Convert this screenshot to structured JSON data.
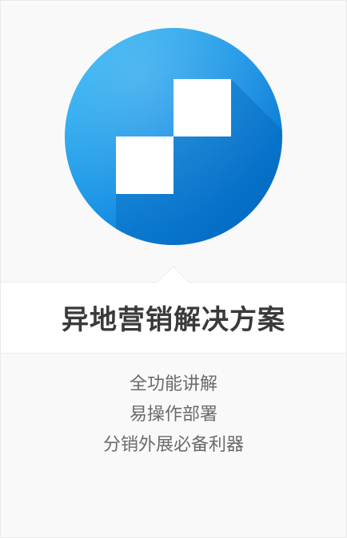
{
  "solution": {
    "title": "异地营销解决方案",
    "features": [
      "全功能讲解",
      "易操作部署",
      "分销外展必备利器"
    ]
  },
  "colors": {
    "circle_light": "#20aef0",
    "circle_dark": "#0073d1",
    "shadow": "#005fb0",
    "square": "#ffffff",
    "title": "#3a3a3a",
    "feature_text": "#6b6b6b",
    "background": "#f9f9f9"
  },
  "icon": {
    "name": "two-white-squares-logo-icon"
  }
}
